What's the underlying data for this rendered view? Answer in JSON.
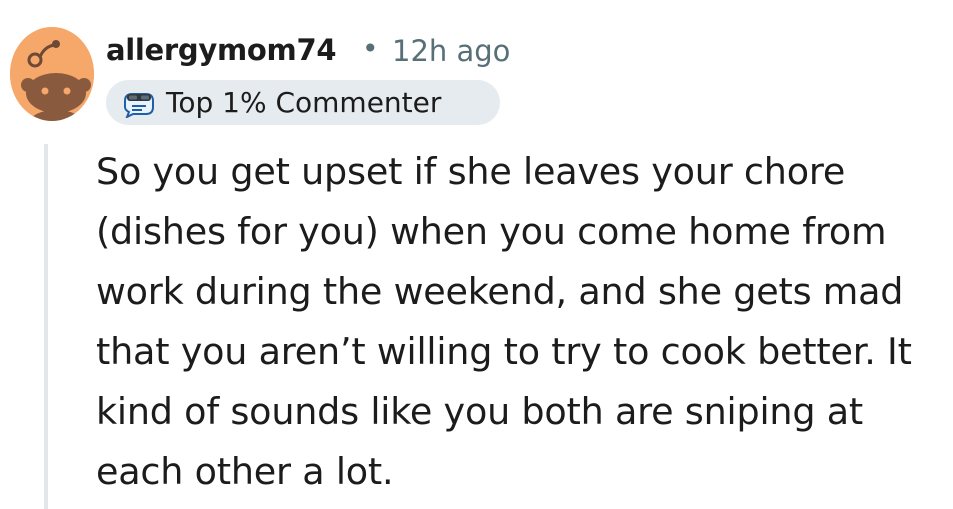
{
  "comment": {
    "author": {
      "username": "allergymom74",
      "avatar_icon": "snoo-avatar-icon",
      "avatar_color": "#f6a86a"
    },
    "separator": "•",
    "timestamp": "12h ago",
    "badge": {
      "icon": "commenter-badge-icon",
      "label": "Top 1% Commenter",
      "background": "#e5ebee"
    },
    "body": "So you get upset if she leaves your chore (dishes for you) when you come home from work during the weekend, and she gets mad that you aren’t willing to try to cook better. It kind of sounds like you both are sniping at each other a lot."
  },
  "colors": {
    "text": "#1c1c1c",
    "meta": "#576f76",
    "thread_line": "#e3e7ea"
  }
}
